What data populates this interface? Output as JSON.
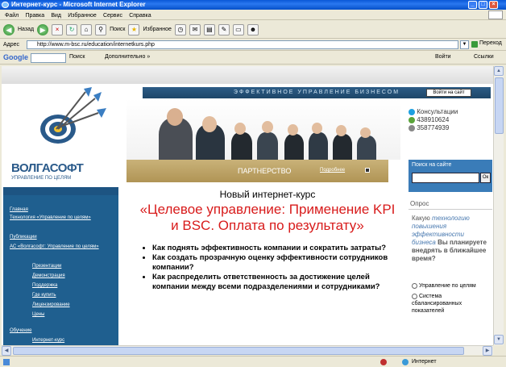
{
  "window": {
    "title": "Интернет-курс - Microsoft Internet Explorer"
  },
  "menu": [
    "Файл",
    "Правка",
    "Вид",
    "Избранное",
    "Сервис",
    "Справка"
  ],
  "toolbar": {
    "back": "Назад",
    "search": "Поиск",
    "favorites": "Избранное"
  },
  "address": {
    "label": "Адрес",
    "url": "http://www.m-bsc.ru/education/internetkurs.php",
    "go": "Переход"
  },
  "googlebar": {
    "logo": "Google",
    "search": "Поиск",
    "more": "Дополнительно »",
    "goto": "Войти",
    "settings": "Ссылки"
  },
  "site": {
    "header": "ЭФФЕКТИВНОЕ УПРАВЛЕНИЕ БИЗНЕСОМ",
    "login": "Войти на сайт",
    "logo": "ВОЛГАСОФТ",
    "logo_sub": "УПРАВЛЕНИЕ ПО ЦЕЛЯМ",
    "partner": "ПАРТНЕРСТВО",
    "partner_more": "Подробнее",
    "consult_label": "Консультации",
    "icq1": "438910624",
    "icq2": "358774939",
    "search_label": "Поиск на сайте",
    "search_btn": "Ок"
  },
  "nav": [
    "Главная",
    "Технология «Управление по целям»",
    "Публикации",
    "АС «Волгасофт: Управление по целям»",
    "Презентации",
    "Демонстрация",
    "Поддержка",
    "Где купить",
    "Лицензирование",
    "Цены",
    "Обучение",
    "Интернет-курс"
  ],
  "main": {
    "intro": "Новый интернет-курс",
    "title": "«Целевое управление: Применение KPI и BSC. Оплата по результату»",
    "bullets": [
      "Как поднять эффективность компании и сократить затраты?",
      "Как создать прозрачную оценку эффективности сотрудников компании?",
      "Как распределить ответственность за достижение целей компании между всеми подразделениями и сотрудниками?"
    ]
  },
  "poll": {
    "title": "Опрос",
    "question_a": "Какую",
    "question_b": "технологию повышения эффективности бизнеса",
    "question_c": "Вы планируете внедрять в ближайшее время?",
    "options": [
      "Управление по целям",
      "Система сбалансированных показателей"
    ]
  },
  "status": {
    "text": "Интернет"
  },
  "colors": {
    "accent": "#d81b1b",
    "nav": "#1f5f8f",
    "brand": "#2a5a8a"
  }
}
